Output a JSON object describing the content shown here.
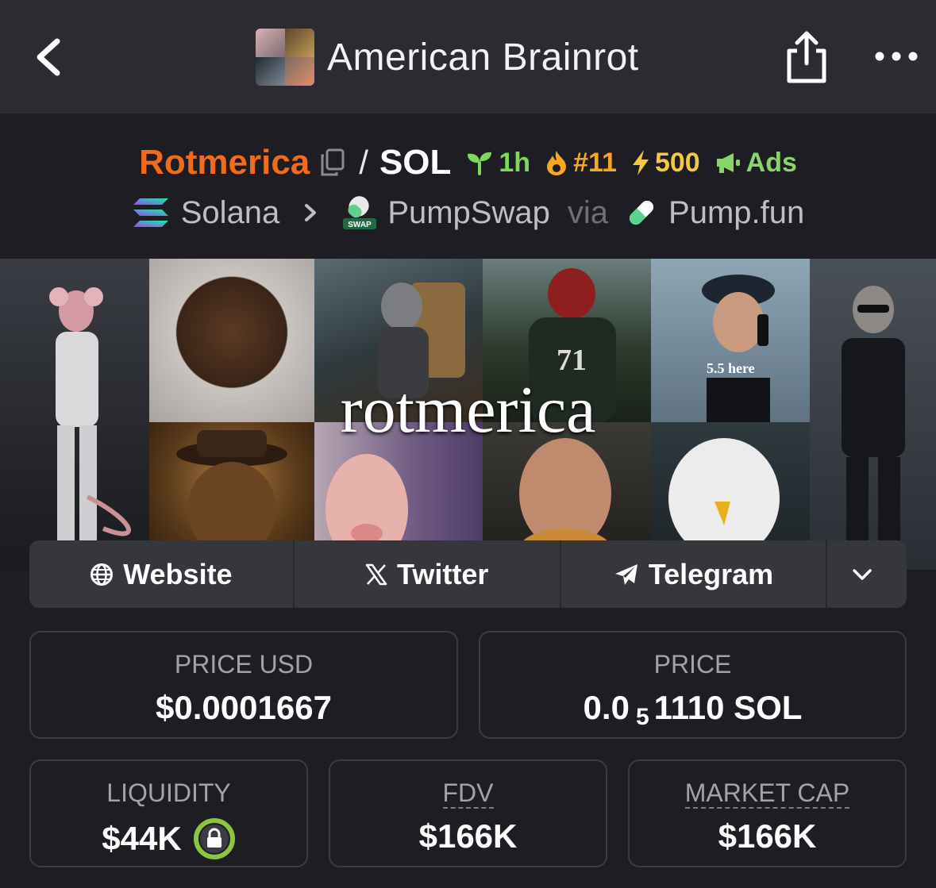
{
  "nav": {
    "title": "American Brainrot"
  },
  "token": {
    "name": "Rotmerica",
    "quote": "SOL",
    "age": "1h",
    "rank": "#11",
    "boost": "500",
    "ads": "Ads"
  },
  "chain": {
    "network": "Solana",
    "dex": "PumpSwap",
    "via": "via",
    "launchpad": "Pump.fun"
  },
  "banner": {
    "text": "rotmerica",
    "caption": "5.5 here"
  },
  "links": {
    "website": "Website",
    "twitter": "Twitter",
    "telegram": "Telegram"
  },
  "stats": {
    "price_usd": {
      "label": "PRICE USD",
      "value": "$0.0001667"
    },
    "price": {
      "label": "PRICE",
      "prefix": "0.0",
      "zeros": "5",
      "suffix": "1110 SOL"
    },
    "liquidity": {
      "label": "LIQUIDITY",
      "value": "$44K"
    },
    "fdv": {
      "label": "FDV",
      "value": "$166K"
    },
    "market_cap": {
      "label": "MARKET CAP",
      "value": "$166K"
    }
  },
  "colors": {
    "token_name": "#f26b1d",
    "age_badge": "#7ed957",
    "rank_badge": "#f5a623",
    "boost_badge": "#f5c842",
    "ads_badge": "#8bd36b",
    "lock_ring": "#8cc63f"
  }
}
